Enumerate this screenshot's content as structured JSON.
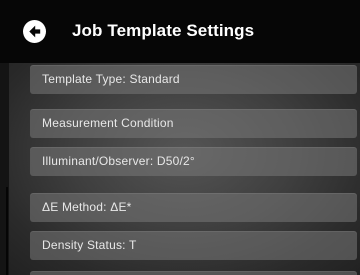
{
  "header": {
    "title": "Job Template Settings",
    "back_icon": "back-arrow-circle-icon"
  },
  "settings": {
    "items": [
      {
        "label": "Template Type: Standard"
      },
      {
        "label": "Measurement Condition"
      },
      {
        "label": "Illuminant/Observer: D50/2°"
      },
      {
        "label": "ΔE Method: ΔE*"
      },
      {
        "label": "Density Status: T"
      }
    ]
  },
  "colors": {
    "header_bg": "#060606",
    "item_text": "#e8e8e8",
    "title_text": "#ffffff"
  }
}
